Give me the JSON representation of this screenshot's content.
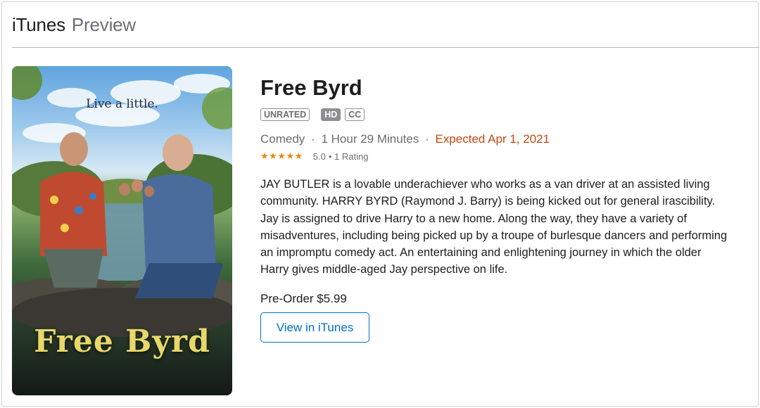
{
  "header": {
    "brand": "iTunes",
    "subtitle": "Preview"
  },
  "poster": {
    "tagline": "Live a little.",
    "title_text": "Free Byrd"
  },
  "movie": {
    "title": "Free Byrd",
    "badges": {
      "rating": "UNRATED",
      "hd": "HD",
      "cc": "CC"
    },
    "genre": "Comedy",
    "separator": "·",
    "duration": "1 Hour 29 Minutes",
    "expected": "Expected Apr 1, 2021",
    "stars": "★★★★★",
    "rating_value": "5.0",
    "rating_count": "• 1 Rating",
    "description": "JAY BUTLER is a lovable underachiever who works as a van driver at an assisted living community. HARRY BYRD (Raymond J. Barry) is being kicked out for general irascibility. Jay is assigned to drive Harry to a new home. Along the way, they have a variety of misadventures, including being picked up by a troupe of burlesque dancers and performing an impromptu comedy act. An entertaining and enlightening journey in which the older Harry gives middle-aged Jay perspective on life.",
    "price": "Pre-Order $5.99",
    "view_button": "View in iTunes"
  },
  "colors": {
    "accent": "#0070c9",
    "expected": "#c4460e",
    "stars": "#e8890c",
    "poster_title": "#e8d86a"
  }
}
